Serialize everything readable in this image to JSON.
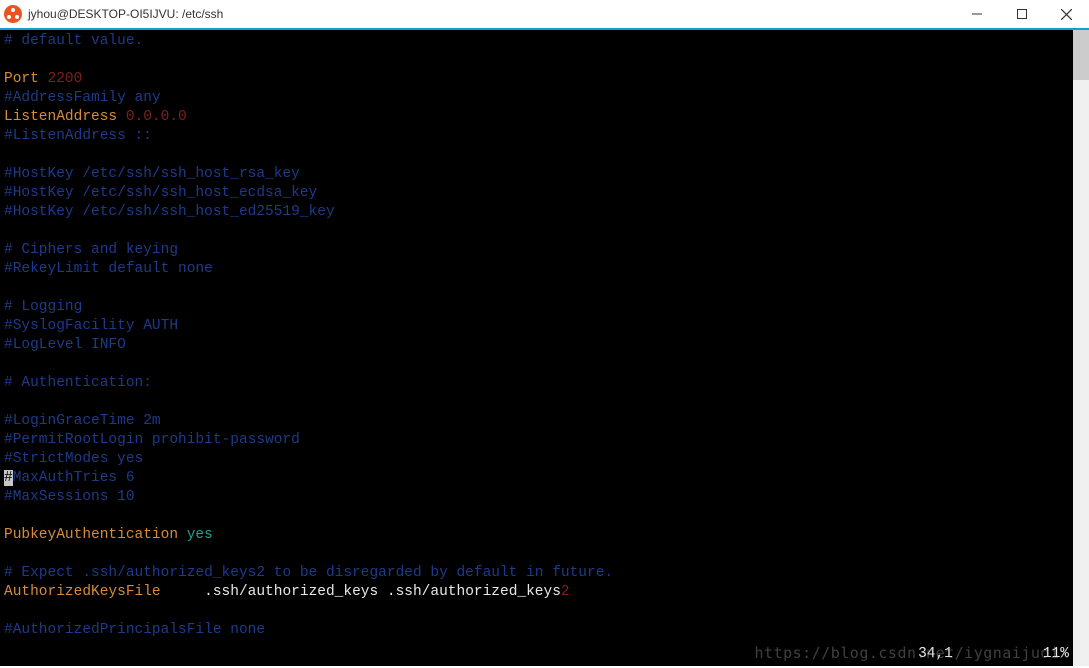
{
  "window": {
    "title": "jyhou@DESKTOP-OI5IJVU: /etc/ssh"
  },
  "terminal": {
    "lines": [
      {
        "parts": [
          {
            "text": "# default value.",
            "cls": "c-blue"
          }
        ]
      },
      {
        "parts": [
          {
            "text": " ",
            "cls": ""
          }
        ]
      },
      {
        "parts": [
          {
            "text": "Port ",
            "cls": "c-orange"
          },
          {
            "text": "2200",
            "cls": "c-darkred"
          }
        ]
      },
      {
        "parts": [
          {
            "text": "#AddressFamily any",
            "cls": "c-blue"
          }
        ]
      },
      {
        "parts": [
          {
            "text": "ListenAddress ",
            "cls": "c-orange"
          },
          {
            "text": "0.0.0.0",
            "cls": "c-darkred"
          }
        ]
      },
      {
        "parts": [
          {
            "text": "#ListenAddress ::",
            "cls": "c-blue"
          }
        ]
      },
      {
        "parts": [
          {
            "text": " ",
            "cls": ""
          }
        ]
      },
      {
        "parts": [
          {
            "text": "#HostKey /etc/ssh/ssh_host_rsa_key",
            "cls": "c-blue"
          }
        ]
      },
      {
        "parts": [
          {
            "text": "#HostKey /etc/ssh/ssh_host_ecdsa_key",
            "cls": "c-blue"
          }
        ]
      },
      {
        "parts": [
          {
            "text": "#HostKey /etc/ssh/ssh_host_ed25519_key",
            "cls": "c-blue"
          }
        ]
      },
      {
        "parts": [
          {
            "text": " ",
            "cls": ""
          }
        ]
      },
      {
        "parts": [
          {
            "text": "# Ciphers and keying",
            "cls": "c-blue"
          }
        ]
      },
      {
        "parts": [
          {
            "text": "#RekeyLimit default none",
            "cls": "c-blue"
          }
        ]
      },
      {
        "parts": [
          {
            "text": " ",
            "cls": ""
          }
        ]
      },
      {
        "parts": [
          {
            "text": "# Logging",
            "cls": "c-blue"
          }
        ]
      },
      {
        "parts": [
          {
            "text": "#SyslogFacility AUTH",
            "cls": "c-blue"
          }
        ]
      },
      {
        "parts": [
          {
            "text": "#LogLevel INFO",
            "cls": "c-blue"
          }
        ]
      },
      {
        "parts": [
          {
            "text": " ",
            "cls": ""
          }
        ]
      },
      {
        "parts": [
          {
            "text": "# Authentication:",
            "cls": "c-blue"
          }
        ]
      },
      {
        "parts": [
          {
            "text": " ",
            "cls": ""
          }
        ]
      },
      {
        "parts": [
          {
            "text": "#LoginGraceTime 2m",
            "cls": "c-blue"
          }
        ]
      },
      {
        "parts": [
          {
            "text": "#PermitRootLogin prohibit-password",
            "cls": "c-blue"
          }
        ]
      },
      {
        "parts": [
          {
            "text": "#StrictModes yes",
            "cls": "c-blue"
          }
        ]
      },
      {
        "parts": [
          {
            "text": "#",
            "cls": "cursor"
          },
          {
            "text": "MaxAuthTries 6",
            "cls": "c-blue"
          }
        ]
      },
      {
        "parts": [
          {
            "text": "#MaxSessions 10",
            "cls": "c-blue"
          }
        ]
      },
      {
        "parts": [
          {
            "text": " ",
            "cls": ""
          }
        ]
      },
      {
        "parts": [
          {
            "text": "PubkeyAuthentication ",
            "cls": "c-orange"
          },
          {
            "text": "yes",
            "cls": "c-teal"
          }
        ]
      },
      {
        "parts": [
          {
            "text": " ",
            "cls": ""
          }
        ]
      },
      {
        "parts": [
          {
            "text": "# Expect .ssh/authorized_keys2 to be disregarded by default in future.",
            "cls": "c-blue"
          }
        ]
      },
      {
        "parts": [
          {
            "text": "AuthorizedKeysFile",
            "cls": "c-orange"
          },
          {
            "text": "     .ssh/authorized_keys .ssh/authorized_keys",
            "cls": "c-white"
          },
          {
            "text": "2",
            "cls": "c-darkred"
          }
        ]
      },
      {
        "parts": [
          {
            "text": " ",
            "cls": ""
          }
        ]
      },
      {
        "parts": [
          {
            "text": "#AuthorizedPrincipalsFile none",
            "cls": "c-blue"
          }
        ]
      }
    ],
    "status": {
      "pos": "34,1",
      "pct": "11%"
    }
  },
  "watermark": "https://blog.csdn.net/iygnaijuoix"
}
